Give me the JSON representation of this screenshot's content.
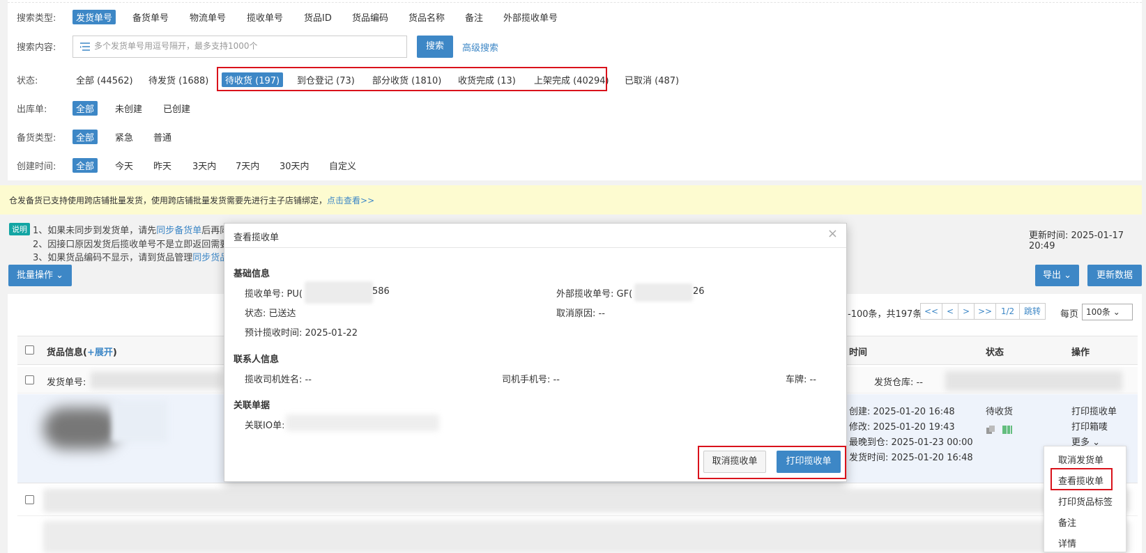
{
  "filters": {
    "search_type": {
      "label": "搜索类型:",
      "options": [
        "发货单号",
        "备货单号",
        "物流单号",
        "揽收单号",
        "货品ID",
        "货品编码",
        "货品名称",
        "备注",
        "外部揽收单号"
      ],
      "active": 0
    },
    "search_content": {
      "label": "搜索内容:",
      "placeholder": "多个发货单号用逗号隔开，最多支持1000个",
      "search_button": "搜索",
      "advanced_link": "高级搜索"
    },
    "status": {
      "label": "状态:",
      "options": [
        "全部 (44562)",
        "待发货 (1688)",
        "待收货 (197)",
        "到仓登记 (73)",
        "部分收货 (1810)",
        "收货完成 (13)",
        "上架完成 (40294)",
        "已取消 (487)"
      ],
      "active": 2
    },
    "outbound": {
      "label": "出库单:",
      "options": [
        "全部",
        "未创建",
        "已创建"
      ],
      "active": 0
    },
    "stock_type": {
      "label": "备货类型:",
      "options": [
        "全部",
        "紧急",
        "普通"
      ],
      "active": 0
    },
    "created_time": {
      "label": "创建时间:",
      "options": [
        "全部",
        "今天",
        "昨天",
        "3天内",
        "7天内",
        "30天内",
        "自定义"
      ],
      "active": 0
    }
  },
  "notice": {
    "text": "仓发备货已支持使用跨店铺批量发货，使用跨店铺批量发货需要先进行主子店铺绑定，",
    "link": "点击查看>>"
  },
  "explain": {
    "tag": "说明",
    "line1_text": "1、如果未同步到发货单，请先",
    "line1_link": "同步备货单",
    "line1_after": "后再同",
    "line2_text": "2、因接口原因发货后揽收单号不是立即返回需要",
    "line3_text": "3、如果货品编码不显示，请到货品管理",
    "line3_link": "同步货品"
  },
  "update_time": "更新时间: 2025-01-17 20:49",
  "toolbar": {
    "batch_button": "批量操作",
    "export_button": "导出",
    "refresh_button": "更新数据"
  },
  "pager": {
    "range": "-100条，共197条",
    "first": "<<",
    "prev": "<",
    "next": ">",
    "last": ">>",
    "page": "1/2",
    "jump": "跳转",
    "per_page_label": "每页",
    "per_page_value": "100条"
  },
  "table": {
    "headers": {
      "goods": "货品信息(",
      "expand": "+展开",
      "goods_close": ")",
      "time": "时间",
      "status": "状态",
      "actions": "操作"
    },
    "subrow": {
      "shipment_label": "发货单号:",
      "warehouse_label": "发货仓库: --"
    },
    "row": {
      "created": "创建: 2025-01-20 16:48",
      "modified": "修改: 2025-01-20 19:43",
      "latest_arrival": "最晚到仓: 2025-01-23 00:00",
      "ship_time": "发货时间: 2025-01-20 16:48",
      "status": "待收货",
      "action_print_pickup": "打印揽收单",
      "action_print_box": "打印箱唛",
      "action_more": "更多"
    }
  },
  "more_menu": {
    "items": [
      "取消发货单",
      "查看揽收单",
      "打印货品标签",
      "备注",
      "详情"
    ],
    "highlighted": 1
  },
  "modal": {
    "title": "查看揽收单",
    "close": "×",
    "basic_section": "基础信息",
    "pickup_no_label": "揽收单号: PU(",
    "pickup_no_tail": "586",
    "external_no_label": "外部揽收单号: GF(",
    "external_no_tail": "26",
    "status_label": "状态: 已送达",
    "cancel_reason_label": "取消原因: --",
    "eta_label": "预计揽收时间: 2025-01-22",
    "contact_section": "联系人信息",
    "driver_name": "揽收司机姓名: --",
    "driver_phone": "司机手机号: --",
    "plate": "车牌: --",
    "related_section": "关联单据",
    "related_io": "关联IO单:",
    "cancel_button": "取消揽收单",
    "print_button": "打印揽收单"
  },
  "colors": {
    "primary": "#3d87c6",
    "highlight_border": "#d9121b",
    "notice_bg": "#fdfbd0",
    "explain_tag": "#13a5a3"
  }
}
